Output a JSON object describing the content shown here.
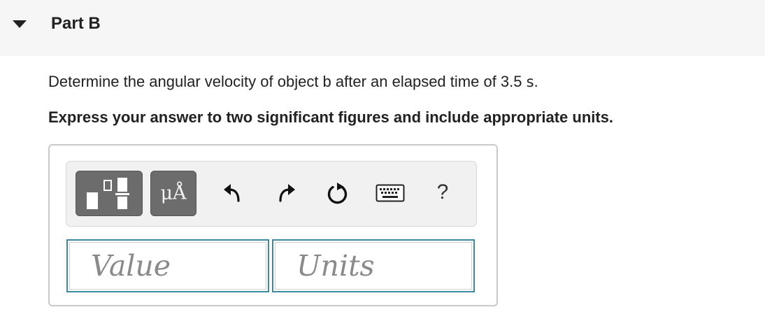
{
  "part": {
    "title": "Part B"
  },
  "question": {
    "text": "Determine the angular velocity of object b after an elapsed time of 3.5 ",
    "unit": "s",
    "end": "."
  },
  "instruction": "Express your answer to two significant figures and include appropriate units.",
  "toolbar": {
    "templates_icon": "fraction-templates-icon",
    "units_label": "μÅ",
    "undo_icon": "undo-arrow-icon",
    "redo_icon": "redo-arrow-icon",
    "reset_icon": "reset-icon",
    "keyboard_icon": "keyboard-icon",
    "help_label": "?"
  },
  "inputs": {
    "value_placeholder": "Value",
    "units_placeholder": "Units"
  },
  "colors": {
    "header_bg": "#f6f6f6",
    "toolbar_button": "#6c6c6c",
    "input_border": "#3f8aa0"
  }
}
